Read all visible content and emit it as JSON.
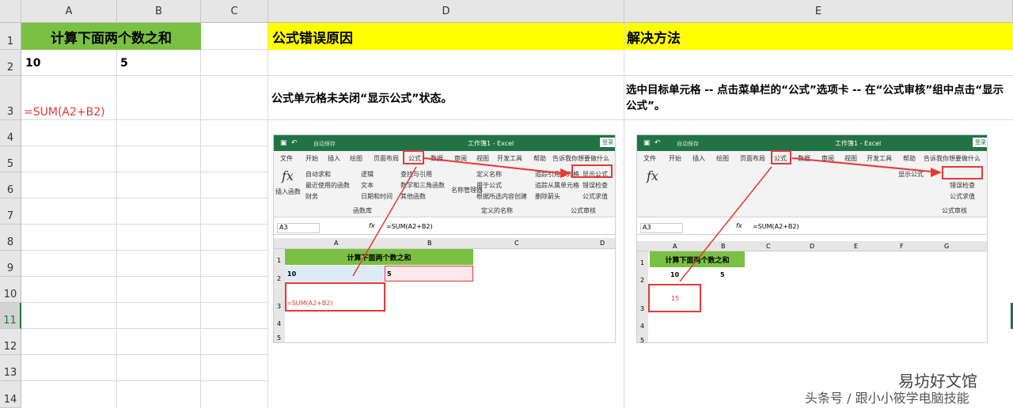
{
  "columns": [
    "A",
    "B",
    "C",
    "D",
    "E"
  ],
  "rows": [
    "1",
    "2",
    "3",
    "4",
    "5",
    "6",
    "7",
    "8",
    "9",
    "10",
    "11",
    "12",
    "13",
    "14"
  ],
  "cells": {
    "A1": "计算下面两个数之和",
    "A2": "10",
    "B2": "5",
    "A3": "=SUM(A2+B2)",
    "D1": "公式错误原因",
    "E1": "解决方法",
    "D3": "公式单元格未关闭“显示公式”状态。",
    "E3": "选中目标单元格 -- 点击菜单栏的“公式”选项卡 -- 在“公式审核”组中点击“显示公式”。"
  },
  "shot_left": {
    "title": "工作簿1 - Excel",
    "autosave": "自动保存",
    "login": "登录",
    "menu": [
      "文件",
      "开始",
      "插入",
      "绘图",
      "页面布局",
      "公式",
      "数据",
      "审阅",
      "视图",
      "开发工具",
      "帮助"
    ],
    "tell_me": "告诉我你想要做什么",
    "ribbon": {
      "insert_fn": "插入函数",
      "autosum": "自动求和",
      "recent": "最近使用的函数",
      "financial": "财务",
      "logical": "逻辑",
      "text": "文本",
      "datetime": "日期和时间",
      "lookup": "查找与引用",
      "math": "数学和三角函数",
      "other": "其他函数",
      "lib_group": "函数库",
      "name_mgr": "名称管理器",
      "define_name": "定义名称",
      "use_formula": "用于公式",
      "from_sel": "根据所选内容创建",
      "names_group": "定义的名称",
      "trace_prec": "追踪引用单元格",
      "trace_dep": "追踪从属单元格",
      "remove_arrows": "删除箭头",
      "show_formulas": "显示公式",
      "error_check": "错误检查",
      "eval_formula": "公式求值",
      "audit_group": "公式审核"
    },
    "namebox": "A3",
    "formula": "=SUM(A2+B2)",
    "cols": [
      "A",
      "B",
      "C",
      "D"
    ],
    "rows": [
      "1",
      "2",
      "3",
      "4",
      "5"
    ],
    "a1": "计算下面两个数之和",
    "a2": "10",
    "b2": "5",
    "a3": "=SUM(A2+B2)"
  },
  "shot_right": {
    "title": "工作簿1 - Excel",
    "autosave": "自动保存",
    "login": "登录",
    "menu": [
      "文件",
      "开始",
      "插入",
      "绘图",
      "页面布局",
      "公式",
      "数据",
      "审阅",
      "视图",
      "开发工具",
      "帮助"
    ],
    "tell_me": "告诉我你想要做什么",
    "namebox": "A3",
    "formula": "=SUM(A2+B2)",
    "cols": [
      "A",
      "B",
      "C",
      "D",
      "E",
      "F",
      "G"
    ],
    "rows": [
      "1",
      "2",
      "3",
      "4",
      "5"
    ],
    "a1": "计算下面两个数之和",
    "a2": "10",
    "b2": "5",
    "a3": "15",
    "show_formulas": "显示公式",
    "error_check": "错误检查",
    "eval_formula": "公式求值",
    "audit_group": "公式审核"
  },
  "watermark": {
    "line1": "易坊好文馆",
    "line2": "头条号 / 跟小小筱学电脑技能"
  },
  "colors": {
    "green": "#7ac143",
    "yellow": "#ffff00",
    "red": "#e53935",
    "excel_green": "#217346"
  }
}
